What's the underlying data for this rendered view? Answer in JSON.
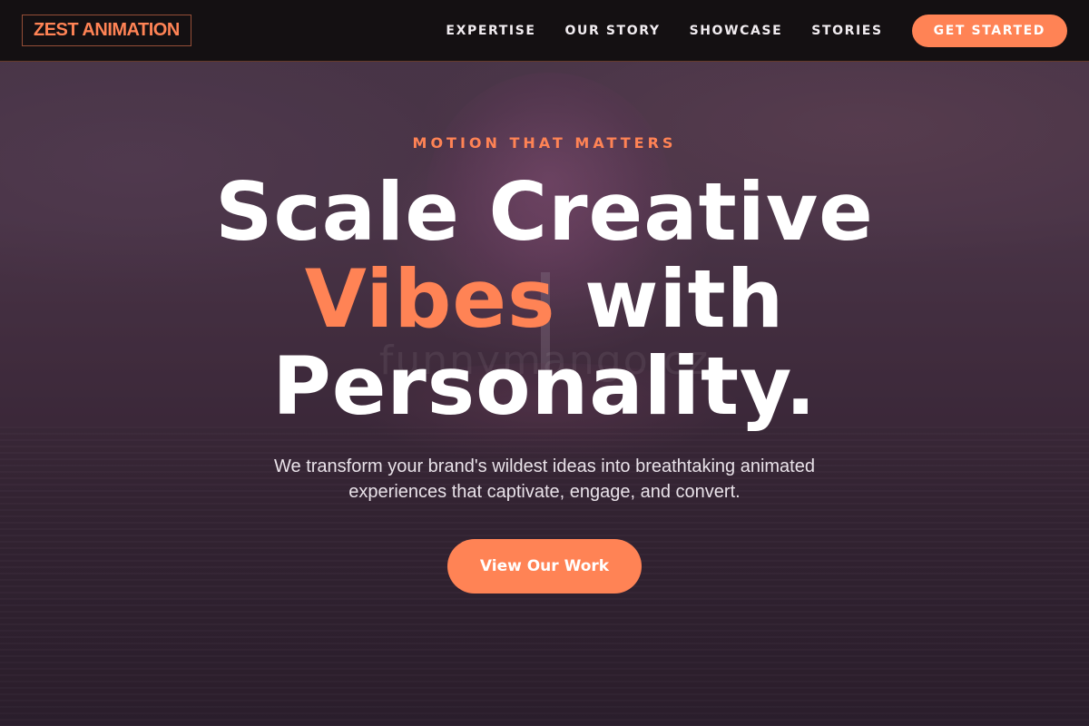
{
  "header": {
    "logo": "ZEST ANIMATION",
    "nav": [
      {
        "label": "EXPERTISE"
      },
      {
        "label": "OUR STORY"
      },
      {
        "label": "SHOWCASE"
      },
      {
        "label": "STORIES"
      }
    ],
    "cta_label": "GET STARTED"
  },
  "hero": {
    "eyebrow": "MOTION THAT MATTERS",
    "headline_line1": "Scale Creative",
    "headline_accent": "Vibes",
    "headline_line2_rest": " with",
    "headline_line3": "Personality.",
    "subtitle": "We transform your brand's wildest ideas into breathtaking animated experiences that captivate, engage, and convert.",
    "button_label": "View Our Work",
    "watermark": "funnymango.cz"
  },
  "colors": {
    "accent": "#ff8355",
    "header_bg": "#141012",
    "text": "#ffffff"
  }
}
